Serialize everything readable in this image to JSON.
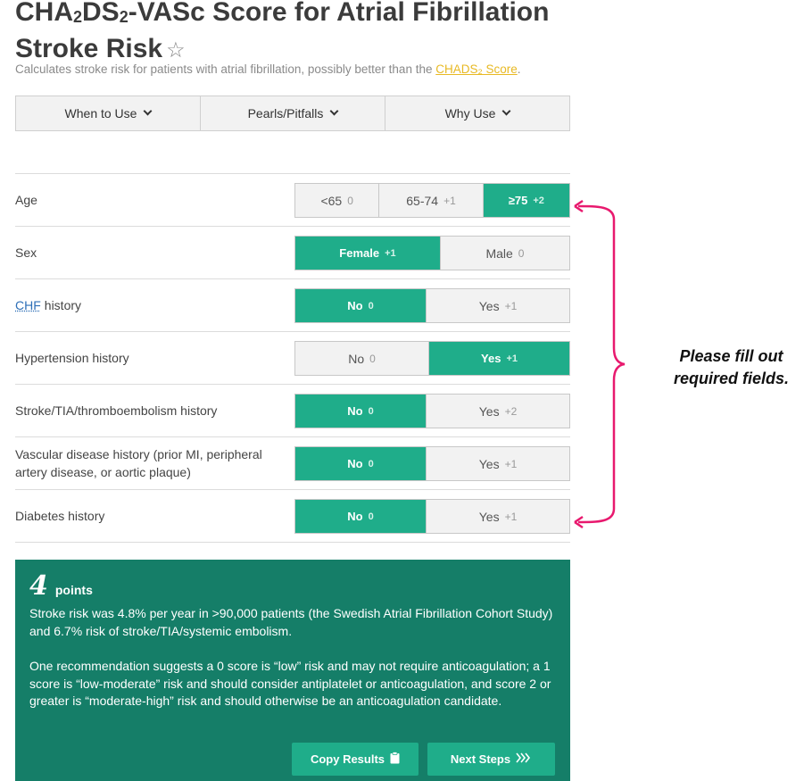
{
  "header": {
    "title_part1": "CHA",
    "title_sub1": "2",
    "title_part2": "DS",
    "title_sub2": "2",
    "title_part3": "-VASc Score for Atrial Fibrillation Stroke Risk",
    "star_icon": "☆",
    "subtitle_text": "Calculates stroke risk for patients with atrial fibrillation, possibly better than the ",
    "subtitle_link": "CHADS₂ Score",
    "subtitle_end": "."
  },
  "tabs": [
    {
      "label": "When to Use"
    },
    {
      "label": "Pearls/Pitfalls"
    },
    {
      "label": "Why Use"
    }
  ],
  "rows": {
    "age": {
      "label": "Age",
      "options": [
        {
          "text": "<65",
          "pts": "0"
        },
        {
          "text": "65-74",
          "pts": "+1"
        },
        {
          "text": "≥75",
          "pts": "+2"
        }
      ],
      "selected": 2
    },
    "sex": {
      "label": "Sex",
      "options": [
        {
          "text": "Female",
          "pts": "+1"
        },
        {
          "text": "Male",
          "pts": "0"
        }
      ],
      "selected": 0
    },
    "chf": {
      "label_abbr": "CHF",
      "label_rest": "history",
      "options": [
        {
          "text": "No",
          "pts": "0"
        },
        {
          "text": "Yes",
          "pts": "+1"
        }
      ],
      "selected": 0
    },
    "htn": {
      "label": "Hypertension history",
      "options": [
        {
          "text": "No",
          "pts": "0"
        },
        {
          "text": "Yes",
          "pts": "+1"
        }
      ],
      "selected": 1
    },
    "stroke": {
      "label": "Stroke/TIA/thromboembolism history",
      "options": [
        {
          "text": "No",
          "pts": "0"
        },
        {
          "text": "Yes",
          "pts": "+2"
        }
      ],
      "selected": 0
    },
    "vascular": {
      "label": "Vascular disease history (prior MI, peripheral artery disease, or aortic plaque)",
      "options": [
        {
          "text": "No",
          "pts": "0"
        },
        {
          "text": "Yes",
          "pts": "+1"
        }
      ],
      "selected": 0
    },
    "diabetes": {
      "label": "Diabetes history",
      "options": [
        {
          "text": "No",
          "pts": "0"
        },
        {
          "text": "Yes",
          "pts": "+1"
        }
      ],
      "selected": 0
    }
  },
  "result": {
    "score": "4",
    "unit": "points",
    "para1": "Stroke risk was 4.8% per year in >90,000 patients (the Swedish Atrial Fibrillation Cohort Study) and 6.7% risk of stroke/TIA/systemic embolism.",
    "para2": "One recommendation suggests a 0 score is “low” risk and may not require anticoagulation; a 1 score is “low-moderate” risk and should consider antiplatelet or anticoagulation, and score 2 or greater is “moderate-high” risk and should otherwise be an anticoagulation candidate.",
    "copy_label": "Copy Results",
    "copy_icon": "clipboard-icon",
    "next_label": "Next Steps",
    "next_icon": "triple-chevron-right-icon"
  },
  "annotation": {
    "line1": "Please fill out",
    "line2": "required fields.",
    "color": "#e8196e"
  },
  "colors": {
    "accent": "#1fad8a",
    "result_bg": "#157e68",
    "link": "#e8b923"
  }
}
